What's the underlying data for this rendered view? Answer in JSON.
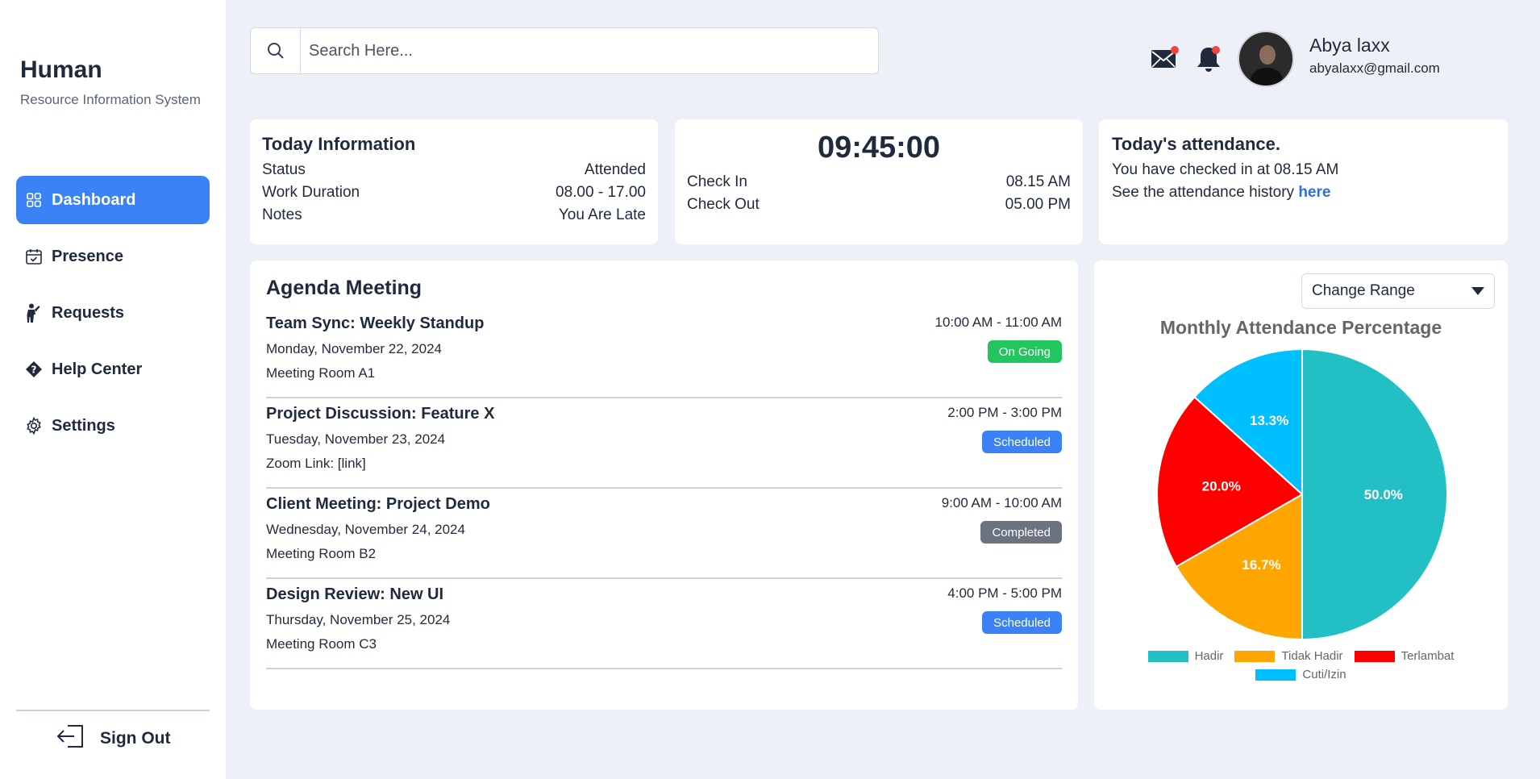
{
  "brand": {
    "title": "Human",
    "subtitle": "Resource Information System"
  },
  "nav": [
    {
      "label": "Dashboard",
      "icon": "grid-icon",
      "active": true
    },
    {
      "label": "Presence",
      "icon": "calendar-check-icon",
      "active": false
    },
    {
      "label": "Requests",
      "icon": "person-icon",
      "active": false
    },
    {
      "label": "Help Center",
      "icon": "question-diamond-icon",
      "active": false
    },
    {
      "label": "Settings",
      "icon": "gear-icon",
      "active": false
    }
  ],
  "signout": {
    "label": "Sign Out",
    "icon": "sign-out-icon"
  },
  "search": {
    "placeholder": "Search Here...",
    "value": ""
  },
  "user": {
    "name": "Abya laxx",
    "email": "abyalaxx@gmail.com"
  },
  "today_info": {
    "title": "Today Information",
    "rows": [
      {
        "label": "Status",
        "value": "Attended"
      },
      {
        "label": "Work Duration",
        "value": "08.00 - 17.00"
      },
      {
        "label": "Notes",
        "value": "You Are Late"
      }
    ]
  },
  "clock": {
    "time": "09:45:00",
    "check_in_label": "Check In",
    "check_in_value": "08.15 AM",
    "check_out_label": "Check Out",
    "check_out_value": "05.00 PM"
  },
  "attendance": {
    "title": "Today's attendance.",
    "checked_text": "You have checked in at 08.15 AM",
    "history_text": "See the attendance history ",
    "history_link": "here"
  },
  "agenda": {
    "title": "Agenda Meeting",
    "meetings": [
      {
        "title": "Team Sync: Weekly Standup",
        "date": "Monday, November 22, 2024",
        "location": "Meeting Room A1",
        "time": "10:00 AM - 11:00 AM",
        "status": "On Going"
      },
      {
        "title": "Project Discussion: Feature X",
        "date": "Tuesday, November 23, 2024",
        "location": "Zoom Link: [link]",
        "time": "2:00 PM - 3:00 PM",
        "status": "Scheduled"
      },
      {
        "title": "Client Meeting: Project Demo",
        "date": "Wednesday, November 24, 2024",
        "location": "Meeting Room B2",
        "time": "9:00 AM - 10:00 AM",
        "status": "Completed"
      },
      {
        "title": "Design Review: New UI",
        "date": "Thursday, November 25, 2024",
        "location": "Meeting Room C3",
        "time": "4:00 PM - 5:00 PM",
        "status": "Scheduled"
      }
    ]
  },
  "colors": {
    "accent": "#3b82f6",
    "status_ongoing": "#22c55e",
    "status_scheduled": "#3b82f6",
    "status_completed": "#6b7280"
  },
  "range_select": {
    "label": "Change Range"
  },
  "chart_data": {
    "type": "pie",
    "title": "Monthly Attendance Percentage",
    "categories": [
      "Hadir",
      "Tidak Hadir",
      "Terlambat",
      "Cuti/Izin"
    ],
    "values": [
      50.0,
      16.7,
      20.0,
      13.3
    ],
    "labels": [
      "50.0%",
      "16.7%",
      "20.0%",
      "13.3%"
    ],
    "colors": [
      "#22c0c4",
      "#ffa500",
      "#ff0000",
      "#00bfff"
    ],
    "legend": "bottom"
  }
}
